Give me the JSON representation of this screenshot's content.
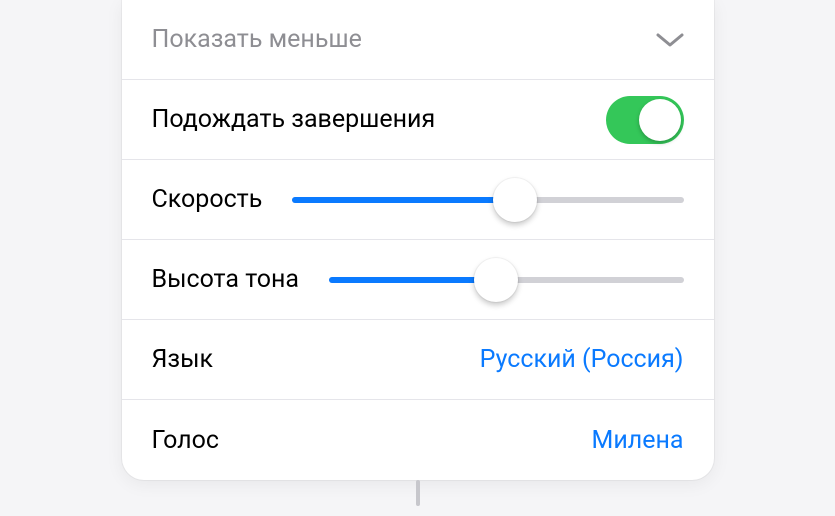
{
  "showLess": {
    "label": "Показать меньше"
  },
  "wait": {
    "label": "Подождать завершения",
    "on": true
  },
  "speed": {
    "label": "Скорость",
    "value": 0.57
  },
  "pitch": {
    "label": "Высота тона",
    "value": 0.47
  },
  "language": {
    "label": "Язык",
    "value": "Русский (Россия)"
  },
  "voice": {
    "label": "Голос",
    "value": "Милена"
  },
  "colors": {
    "accent": "#0a7aff",
    "toggleOn": "#34c759"
  }
}
